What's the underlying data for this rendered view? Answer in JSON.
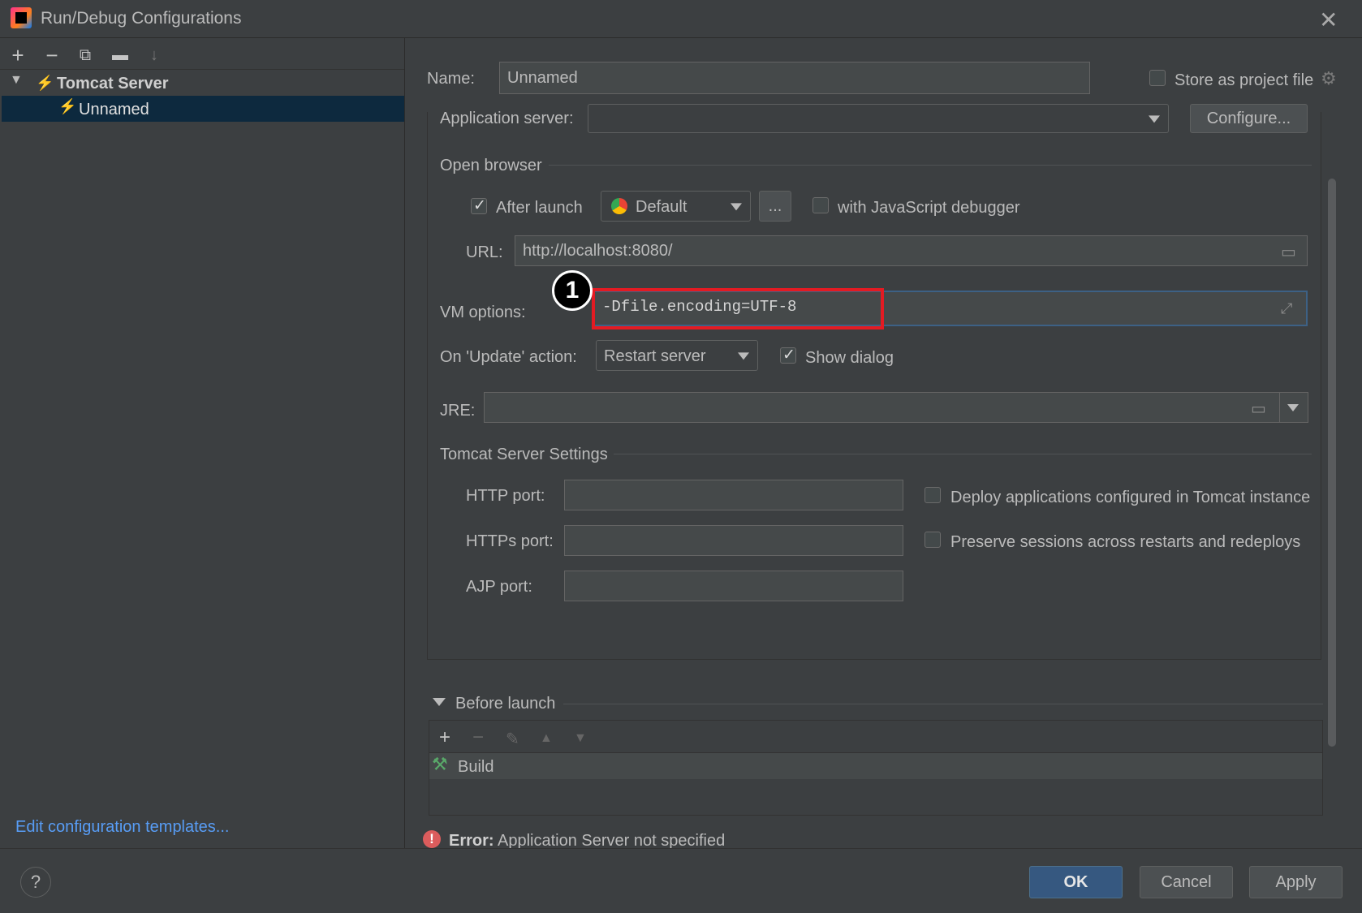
{
  "window": {
    "title": "Run/Debug Configurations",
    "close": "✕"
  },
  "left": {
    "toolbar_icons": [
      "add-icon",
      "remove-icon",
      "copy-icon",
      "folder-add-icon",
      "sort-icon"
    ],
    "tree": {
      "group": "Tomcat Server",
      "item": "Unnamed"
    },
    "edit_templates": "Edit configuration templates..."
  },
  "config": {
    "name_label": "Name:",
    "name_value": "Unnamed",
    "store_label": "Store as project file",
    "app_server_label": "Application server:",
    "app_server_value": "",
    "configure_btn": "Configure...",
    "open_browser_title": "Open browser",
    "after_launch_label": "After launch",
    "browser_value": "Default",
    "ellipsis_btn": "...",
    "js_debugger_label": "with JavaScript debugger",
    "url_label": "URL:",
    "url_value": "http://localhost:8080/",
    "vm_label": "VM options:",
    "vm_value": "-Dfile.encoding=UTF-8",
    "badge": "1",
    "update_label": "On 'Update' action:",
    "update_value": "Restart server",
    "show_dialog_label": "Show dialog",
    "jre_label": "JRE:",
    "jre_value": "",
    "tomcat_settings_title": "Tomcat Server Settings",
    "http_port_label": "HTTP port:",
    "https_port_label": "HTTPs port:",
    "ajp_port_label": "AJP port:",
    "http_port_value": "",
    "https_port_value": "",
    "ajp_port_value": "",
    "deploy_label": "Deploy applications configured in Tomcat instance",
    "preserve_label": "Preserve sessions across restarts and redeploys"
  },
  "before_launch": {
    "title": "Before launch",
    "items": [
      "Build"
    ]
  },
  "error": {
    "prefix": "Error:",
    "message": "Application Server not specified"
  },
  "footer": {
    "help": "?",
    "ok": "OK",
    "cancel": "Cancel",
    "apply": "Apply"
  },
  "colors": {
    "background": "#3c3f41",
    "selection": "#0d293e",
    "highlight_box": "#e31b23",
    "ok_button": "#365880",
    "link": "#589df6",
    "error": "#db5c5c"
  }
}
